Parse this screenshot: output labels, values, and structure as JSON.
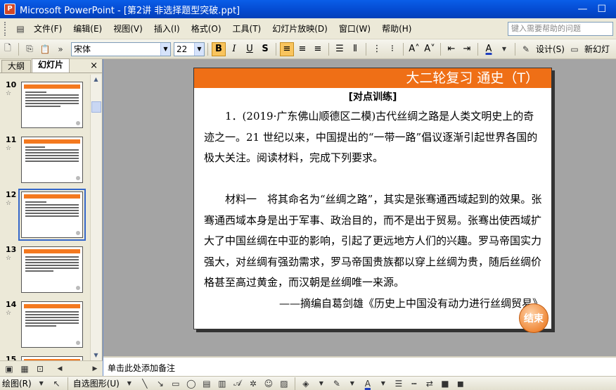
{
  "window": {
    "title": "Microsoft PowerPoint - [第2讲  非选择题型突破.ppt]"
  },
  "menu": {
    "items": [
      "文件(F)",
      "编辑(E)",
      "视图(V)",
      "插入(I)",
      "格式(O)",
      "工具(T)",
      "幻灯片放映(D)",
      "窗口(W)",
      "帮助(H)"
    ],
    "help_placeholder": "键入需要帮助的问题"
  },
  "toolbar": {
    "font_name": "宋体",
    "font_size": "22",
    "bold": "B",
    "italic": "I",
    "underline": "U",
    "shadow": "S",
    "design_label": "设计(S)",
    "new_slide_label": "新幻灯"
  },
  "panel": {
    "tabs": [
      "大纲",
      "幻灯片"
    ],
    "close": "×",
    "slides": [
      {
        "num": "10"
      },
      {
        "num": "11"
      },
      {
        "num": "12"
      },
      {
        "num": "13"
      },
      {
        "num": "14"
      },
      {
        "num": "15"
      }
    ]
  },
  "slide": {
    "header": "大二轮复习  通史（T）",
    "subheading": "[对点训练]",
    "para1": "1．(2019·广东佛山顺德区二模)古代丝绸之路是人类文明史上的奇迹之一。21 世纪以来，中国提出的“一带一路”倡议逐渐引起世界各国的极大关注。阅读材料，完成下列要求。",
    "para2": "材料一　将其命名为“丝绸之路”，其实是张骞通西域起到的效果。张骞通西域本身是出于军事、政治目的，而不是出于贸易。张骞出使西域扩大了中国丝绸在中亚的影响，引起了更远地方人们的兴趣。罗马帝国实力强大，对丝绸有强劲需求，罗马帝国贵族都以穿上丝绸为贵，随后丝绸价格甚至高过黄金，而汉朝是丝绸唯一来源。",
    "source": "——摘编自葛剑雄《历史上中国没有动力进行丝绸贸易》",
    "end_button": "结束"
  },
  "notes": {
    "placeholder": "单击此处添加备注"
  },
  "drawbar": {
    "draw_label": "绘图(R)",
    "autoshape_label": "自选图形(U)"
  }
}
